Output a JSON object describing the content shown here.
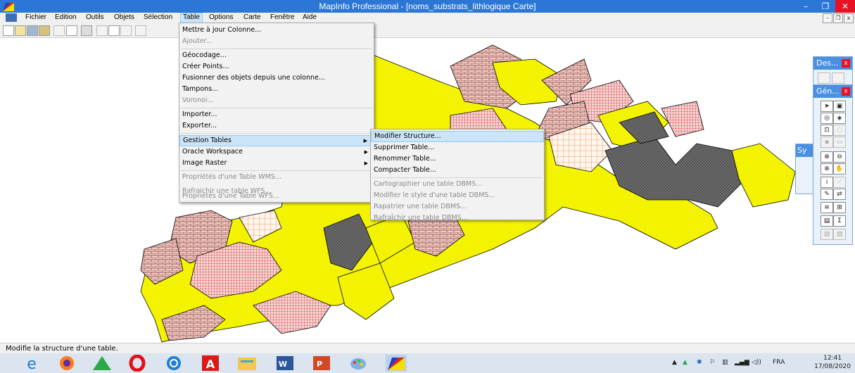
{
  "window": {
    "title": "MapInfo Professional - [noms_substrats_lithlogique Carte]",
    "minimize": "–",
    "restore": "❐",
    "close": "✕"
  },
  "menubar": {
    "items": [
      "Fichier",
      "Edition",
      "Outils",
      "Objets",
      "Sélection",
      "Table",
      "Options",
      "Carte",
      "Fenêtre",
      "Aide"
    ],
    "active": "Table"
  },
  "mdi": {
    "min": "–",
    "restore": "❐",
    "close": "x"
  },
  "table_menu": {
    "items": [
      {
        "label": "Mettre à jour Colonne...",
        "enabled": true
      },
      {
        "label": "Ajouter...",
        "enabled": false
      },
      {
        "label": "Géocodage...",
        "enabled": true
      },
      {
        "label": "Créer Points...",
        "enabled": true
      },
      {
        "label": "Fusionner des objets depuis une colonne...",
        "enabled": true
      },
      {
        "label": "Tampons...",
        "enabled": true
      },
      {
        "label": "Voronoi...",
        "enabled": false
      },
      {
        "label": "Importer...",
        "enabled": true
      },
      {
        "label": "Exporter...",
        "enabled": true
      },
      {
        "label": "Gestion Tables",
        "enabled": true,
        "submenu": true
      },
      {
        "label": "Oracle Workspace",
        "enabled": true,
        "submenu": true
      },
      {
        "label": "Image Raster",
        "enabled": true,
        "submenu": true
      },
      {
        "label": "Propriétés d'une Table WMS...",
        "enabled": false
      },
      {
        "label": "Rafraichir une table WFS...",
        "enabled": false
      },
      {
        "label": "Propriétés d'une Table WFS...",
        "enabled": false
      }
    ]
  },
  "gestion_submenu": {
    "items": [
      {
        "label": "Modifier Structure...",
        "enabled": true
      },
      {
        "label": "Supprimer Table...",
        "enabled": true
      },
      {
        "label": "Renommer Table...",
        "enabled": true
      },
      {
        "label": "Compacter Table...",
        "enabled": true
      },
      {
        "label": "Cartographier une table DBMS...",
        "enabled": false
      },
      {
        "label": "Modifier le style d'une table DBMS...",
        "enabled": false
      },
      {
        "label": "Rapatrier une table DBMS...",
        "enabled": false
      },
      {
        "label": "Rafraîchir une table DBMS...",
        "enabled": false
      }
    ]
  },
  "panels": {
    "des_title": "Des...",
    "gen_title": "Gén...",
    "sy_title": "Sy",
    "close": "x"
  },
  "status": {
    "text": "Modifie la structure d'une table."
  },
  "tray": {
    "lang": "FRA",
    "time": "12:41",
    "date": "17/08/2020"
  },
  "colors": {
    "yellow": "#f5f500",
    "gray": "#6e6e6e",
    "pink": "#f3c0c0",
    "red_grid": "#d43030",
    "orange": "#f08040",
    "taskbar": "#dbe4ef",
    "titlebar": "#2b77d6"
  }
}
